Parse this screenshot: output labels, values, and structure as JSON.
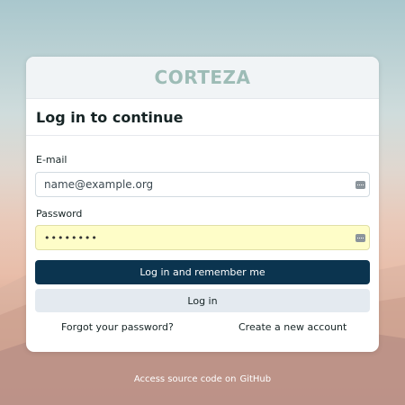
{
  "brand": {
    "logo_text": "CORTEZA"
  },
  "login": {
    "title": "Log in to continue",
    "email_label": "E-mail",
    "email_value": "name@example.org",
    "password_label": "Password",
    "password_value": "••••••••",
    "primary_button": "Log in and remember me",
    "secondary_button": "Log in",
    "forgot_link": "Forgot your password?",
    "create_link": "Create a new account"
  },
  "footer": {
    "text": "Access source code on",
    "link": "GitHub"
  },
  "colors": {
    "primary": "#0b344f",
    "logo": "#9dbcb6",
    "password_autofill_bg": "#fefdc8",
    "secondary_button_bg": "#e4eaf0"
  },
  "icons": {
    "email_field_icon": "password-manager-icon",
    "password_field_icon": "password-manager-icon"
  }
}
